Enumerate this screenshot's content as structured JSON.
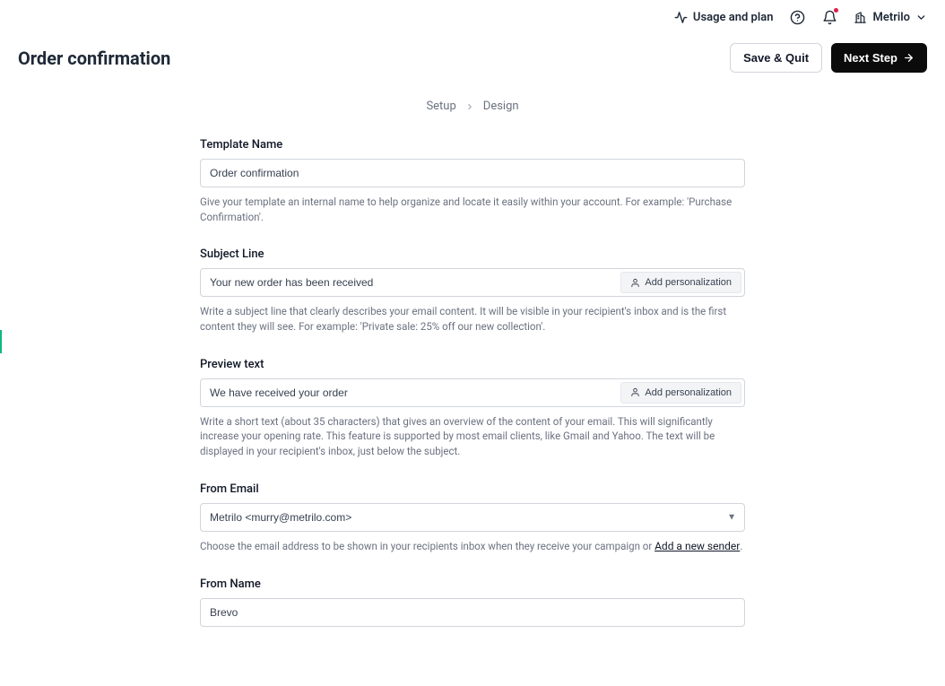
{
  "topbar": {
    "usage_label": "Usage and plan",
    "org_label": "Metrilo"
  },
  "header": {
    "title": "Order confirmation",
    "save_quit_label": "Save & Quit",
    "next_step_label": "Next Step"
  },
  "breadcrumb": {
    "step1": "Setup",
    "step2": "Design"
  },
  "form": {
    "template_name": {
      "label": "Template Name",
      "value": "Order confirmation",
      "helper": "Give your template an internal name to help organize and locate it easily within your account. For example: 'Purchase Confirmation'."
    },
    "subject_line": {
      "label": "Subject Line",
      "value": "Your new order has been received",
      "personalization_btn": "Add personalization",
      "helper": "Write a subject line that clearly describes your email content. It will be visible in your recipient's inbox and is the first content they will see. For example: 'Private sale: 25% off our new collection'."
    },
    "preview_text": {
      "label": "Preview text",
      "value": "We have received your order",
      "personalization_btn": "Add personalization",
      "helper": "Write a short text (about 35 characters) that gives an overview of the content of your email. This will significantly increase your opening rate. This feature is supported by most email clients, like Gmail and Yahoo. The text will be displayed in your recipient's inbox, just below the subject."
    },
    "from_email": {
      "label": "From Email",
      "value": "Metrilo <murry@metrilo.com>",
      "helper_prefix": "Choose the email address to be shown in your recipients inbox when they receive your campaign or ",
      "helper_link": "Add a new sender",
      "helper_suffix": "."
    },
    "from_name": {
      "label": "From Name",
      "value": "Brevo"
    }
  }
}
